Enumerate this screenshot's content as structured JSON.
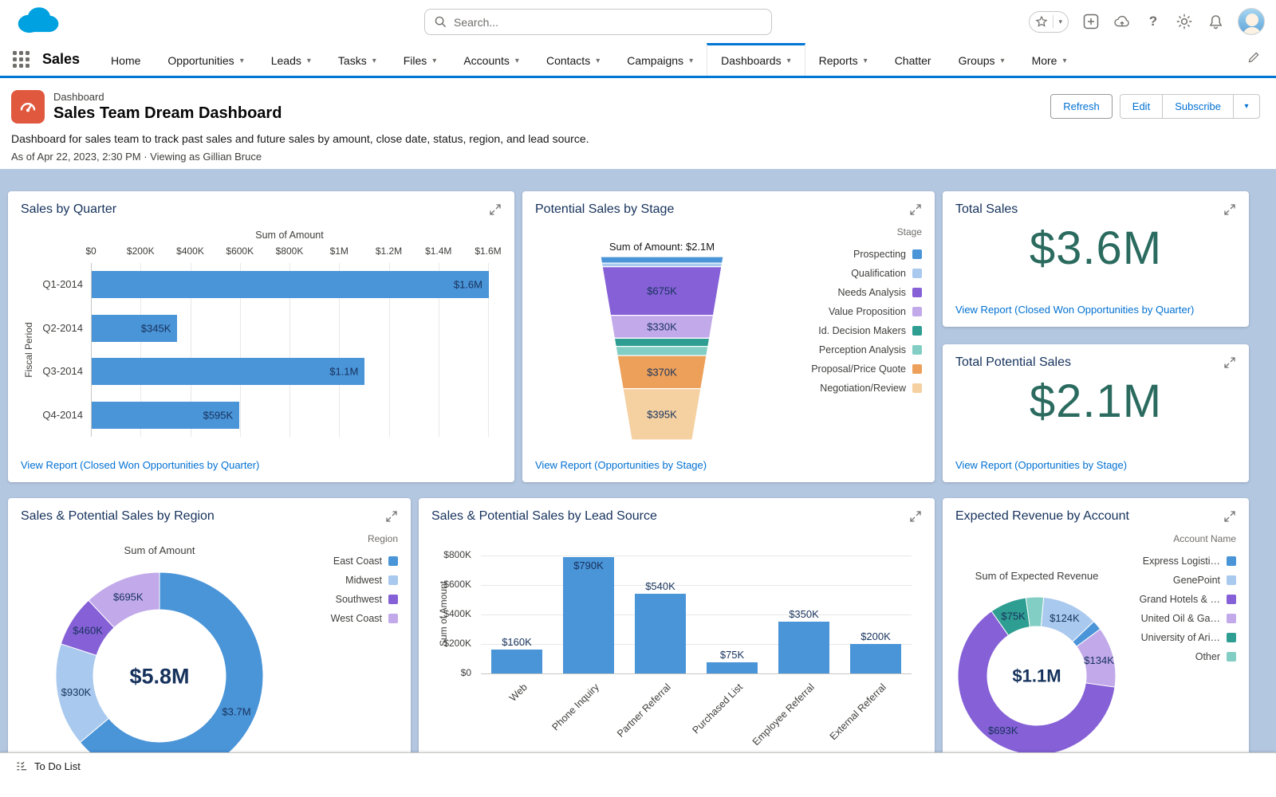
{
  "colors": {
    "blue": "#4a94d8",
    "light_blue": "#a9c9ee",
    "purple": "#8560d6",
    "light_purple": "#c2a9ea",
    "teal": "#2f9e92",
    "light_teal": "#82cec4",
    "orange": "#eda05a",
    "light_orange": "#f5d0a1",
    "accent": "#0176d3",
    "link": "#0070d2",
    "metric": "#2b6b5f"
  },
  "header": {
    "search_placeholder": "Search...",
    "icons": [
      "favorites-star",
      "quick-add",
      "cloud-upload",
      "help",
      "setup-gear",
      "notifications-bell",
      "user-avatar"
    ]
  },
  "nav": {
    "app_name": "Sales",
    "tabs": [
      {
        "label": "Home",
        "caret": false,
        "active": false
      },
      {
        "label": "Opportunities",
        "caret": true,
        "active": false
      },
      {
        "label": "Leads",
        "caret": true,
        "active": false
      },
      {
        "label": "Tasks",
        "caret": true,
        "active": false
      },
      {
        "label": "Files",
        "caret": true,
        "active": false
      },
      {
        "label": "Accounts",
        "caret": true,
        "active": false
      },
      {
        "label": "Contacts",
        "caret": true,
        "active": false
      },
      {
        "label": "Campaigns",
        "caret": true,
        "active": false
      },
      {
        "label": "Dashboards",
        "caret": true,
        "active": true
      },
      {
        "label": "Reports",
        "caret": true,
        "active": false
      },
      {
        "label": "Chatter",
        "caret": false,
        "active": false
      },
      {
        "label": "Groups",
        "caret": true,
        "active": false
      },
      {
        "label": "More",
        "caret": true,
        "active": false
      }
    ]
  },
  "page_header": {
    "type_label": "Dashboard",
    "title": "Sales Team Dream Dashboard",
    "description": "Dashboard for sales team to track past sales and future sales by amount, close date, status, region, and lead source.",
    "meta": "As of Apr 22, 2023, 2:30 PM · Viewing as Gillian Bruce",
    "actions": {
      "refresh": "Refresh",
      "edit": "Edit",
      "subscribe": "Subscribe"
    }
  },
  "cards": {
    "sales_by_quarter": {
      "title": "Sales by Quarter",
      "link": "View Report (Closed Won Opportunities by Quarter)",
      "chart_data": {
        "type": "bar",
        "orientation": "horizontal",
        "axis_title": "Sum of Amount",
        "ylabel": "Fiscal Period",
        "x_ticks": [
          "$0",
          "$200K",
          "$400K",
          "$600K",
          "$800K",
          "$1M",
          "$1.2M",
          "$1.4M",
          "$1.6M"
        ],
        "xlim": [
          0,
          1600000
        ],
        "categories": [
          "Q1-2014",
          "Q2-2014",
          "Q3-2014",
          "Q4-2014"
        ],
        "values": [
          1600000,
          345000,
          1100000,
          595000
        ],
        "value_labels": [
          "$1.6M",
          "$345K",
          "$1.1M",
          "$595K"
        ]
      }
    },
    "potential_sales_by_stage": {
      "title": "Potential Sales by Stage",
      "link": "View Report (Opportunities by Stage)",
      "legend_title": "Stage",
      "legend": [
        {
          "label": "Prospecting",
          "color": "blue"
        },
        {
          "label": "Qualification",
          "color": "light_blue"
        },
        {
          "label": "Needs Analysis",
          "color": "purple"
        },
        {
          "label": "Value Proposition",
          "color": "light_purple"
        },
        {
          "label": "Id. Decision Makers",
          "color": "teal"
        },
        {
          "label": "Perception Analysis",
          "color": "light_teal"
        },
        {
          "label": "Proposal/Price Quote",
          "color": "orange"
        },
        {
          "label": "Negotiation/Review",
          "color": "light_orange"
        }
      ],
      "chart_data": {
        "type": "funnel",
        "total_label": "Sum of Amount: $2.1M",
        "segments": [
          {
            "stage": "Prospecting",
            "color": "blue",
            "value_label": "",
            "height_fraction": 0.035
          },
          {
            "stage": "Qualification",
            "color": "light_blue",
            "value_label": "",
            "height_fraction": 0.02
          },
          {
            "stage": "Needs Analysis",
            "color": "purple",
            "value_label": "$675K",
            "height_fraction": 0.265
          },
          {
            "stage": "Value Proposition",
            "color": "light_purple",
            "value_label": "$330K",
            "height_fraction": 0.125
          },
          {
            "stage": "Id. Decision Makers",
            "color": "teal",
            "value_label": "",
            "height_fraction": 0.045
          },
          {
            "stage": "Perception Analysis",
            "color": "light_teal",
            "value_label": "",
            "height_fraction": 0.05
          },
          {
            "stage": "Proposal/Price Quote",
            "color": "orange",
            "value_label": "$370K",
            "height_fraction": 0.18
          },
          {
            "stage": "Negotiation/Review",
            "color": "light_orange",
            "value_label": "$395K",
            "height_fraction": 0.28
          }
        ]
      }
    },
    "total_sales": {
      "title": "Total Sales",
      "metric": "$3.6M",
      "link": "View Report (Closed Won Opportunities by Quarter)"
    },
    "total_potential_sales": {
      "title": "Total Potential Sales",
      "metric": "$2.1M",
      "link": "View Report (Opportunities by Stage)"
    },
    "region": {
      "title": "Sales & Potential Sales by Region",
      "legend_title": "Region",
      "legend": [
        {
          "label": "East Coast",
          "color": "blue"
        },
        {
          "label": "Midwest",
          "color": "light_blue"
        },
        {
          "label": "Southwest",
          "color": "purple"
        },
        {
          "label": "West Coast",
          "color": "light_purple"
        }
      ],
      "chart_data": {
        "type": "pie",
        "subtype": "donut",
        "subtitle": "Sum of Amount",
        "center_label": "$5.8M",
        "start_angle_deg": 0,
        "segments": [
          {
            "name": "East Coast",
            "color": "blue",
            "value_label": "$3.7M",
            "fraction": 0.639
          },
          {
            "name": "Midwest",
            "color": "light_blue",
            "value_label": "$930K",
            "fraction": 0.161
          },
          {
            "name": "Southwest",
            "color": "purple",
            "value_label": "$460K",
            "fraction": 0.08
          },
          {
            "name": "West Coast",
            "color": "light_purple",
            "value_label": "$695K",
            "fraction": 0.12
          }
        ]
      }
    },
    "lead_source": {
      "title": "Sales & Potential Sales by Lead Source",
      "chart_data": {
        "type": "bar",
        "orientation": "vertical",
        "ylabel": "Sum of Amount",
        "y_ticks": [
          "$0",
          "$200K",
          "$400K",
          "$600K",
          "$800K"
        ],
        "ylim": [
          0,
          800000
        ],
        "categories": [
          "Web",
          "Phone Inquiry",
          "Partner Referral",
          "Purchased List",
          "Employee Referral",
          "External Referral"
        ],
        "values": [
          160000,
          790000,
          540000,
          75000,
          350000,
          200000
        ],
        "value_labels": [
          "$160K",
          "$790K",
          "$540K",
          "$75K",
          "$350K",
          "$200K"
        ]
      }
    },
    "expected_revenue": {
      "title": "Expected Revenue by Account",
      "legend_title": "Account Name",
      "legend": [
        {
          "label": "Express Logisti…",
          "color": "blue"
        },
        {
          "label": "GenePoint",
          "color": "light_blue"
        },
        {
          "label": "Grand Hotels & …",
          "color": "purple"
        },
        {
          "label": "United Oil & Ga…",
          "color": "light_purple"
        },
        {
          "label": "University of Ari…",
          "color": "teal"
        },
        {
          "label": "Other",
          "color": "light_teal"
        }
      ],
      "chart_data": {
        "type": "pie",
        "subtype": "donut",
        "subtitle": "Sum of Expected Revenue",
        "center_label": "$1.1M",
        "start_angle_deg": 5,
        "segments": [
          {
            "name": "GenePoint",
            "color": "light_blue",
            "value_label": "$124K",
            "fraction": 0.115
          },
          {
            "name": "Express Logisti…",
            "color": "blue",
            "value_label": "",
            "fraction": 0.02
          },
          {
            "name": "United Oil & Ga…",
            "color": "light_purple",
            "value_label": "$134K",
            "fraction": 0.124
          },
          {
            "name": "Grand Hotels & …",
            "color": "purple",
            "value_label": "$693K",
            "fraction": 0.63
          },
          {
            "name": "University of Ari…",
            "color": "teal",
            "value_label": "$75K",
            "fraction": 0.075
          },
          {
            "name": "Other",
            "color": "light_teal",
            "value_label": "",
            "fraction": 0.036
          }
        ]
      }
    }
  },
  "utility_bar": {
    "todo_label": "To Do List"
  }
}
